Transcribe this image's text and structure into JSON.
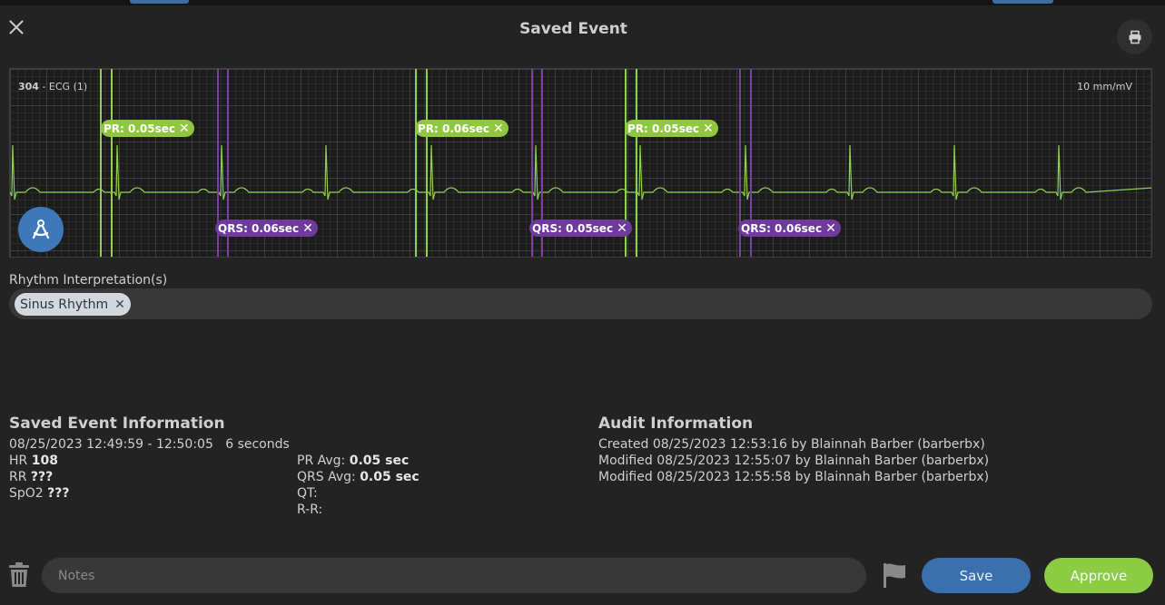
{
  "header": {
    "title": "Saved Event"
  },
  "ecg": {
    "lead_number": "304",
    "lead_name": " - ECG (1)",
    "scale": "10 mm/mV",
    "pr_tags": [
      "PR: 0.05sec",
      "PR: 0.06sec",
      "PR: 0.05sec"
    ],
    "qrs_tags": [
      "QRS: 0.06sec",
      "QRS: 0.05sec",
      "QRS: 0.06sec"
    ],
    "colors": {
      "trace": "#8fd14f",
      "pr": "#8fc83f",
      "qrs": "#6e3a9c"
    }
  },
  "rhythm": {
    "label": "Rhythm Interpretation(s)",
    "chips": [
      "Sinus Rhythm"
    ]
  },
  "saved_event": {
    "title": "Saved Event Information",
    "time_range": "08/25/2023 12:49:59 - 12:50:05",
    "duration": "6 seconds",
    "hr_label": "HR",
    "hr_value": "108",
    "rr_label": "RR",
    "rr_value": "???",
    "spo2_label": "SpO2",
    "spo2_value": "???",
    "pr_avg_label": "PR Avg:",
    "pr_avg_value": "0.05 sec",
    "qrs_avg_label": "QRS Avg:",
    "qrs_avg_value": "0.05 sec",
    "qt_label": "QT:",
    "rr_interval_label": "R-R:"
  },
  "audit": {
    "title": "Audit Information",
    "entries": [
      "Created 08/25/2023 12:53:16 by Blainnah Barber (barberbx)",
      "Modified 08/25/2023 12:55:07 by Blainnah Barber (barberbx)",
      "Modified 08/25/2023 12:55:58 by Blainnah Barber (barberbx)"
    ]
  },
  "footer": {
    "notes_placeholder": "Notes",
    "save_label": "Save",
    "approve_label": "Approve"
  },
  "icons": {
    "close": "close-icon",
    "print": "printer-icon",
    "tool": "caliper-tool-icon",
    "trash": "trash-icon",
    "flag": "flag-icon"
  }
}
